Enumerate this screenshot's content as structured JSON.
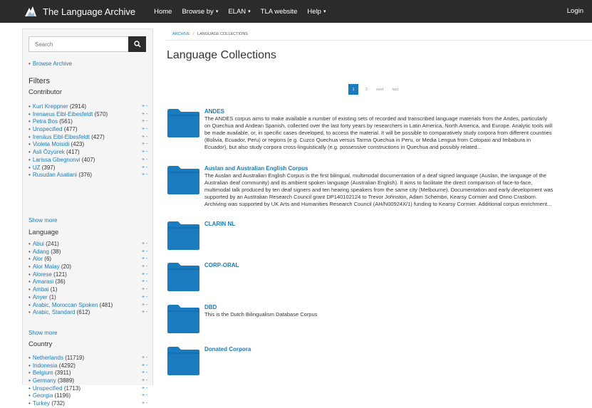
{
  "navbar": {
    "brand": "The Language Archive",
    "items": [
      {
        "label": "Home",
        "dropdown": false
      },
      {
        "label": "Browse by",
        "dropdown": true
      },
      {
        "label": "ELAN",
        "dropdown": true
      },
      {
        "label": "TLA website",
        "dropdown": false
      },
      {
        "label": "Help",
        "dropdown": true
      }
    ],
    "login": "Login",
    "bg_color": "#2b2b2b"
  },
  "sidebar": {
    "search_placeholder": "Search",
    "browse_link": "Browse Archive",
    "filters_heading": "Filters",
    "plus_minus": "+ -",
    "show_more": "Show more",
    "sections": [
      {
        "heading": "Contributor",
        "items": [
          {
            "name": "Kurt Kreppner",
            "count": "(2914)"
          },
          {
            "name": "Irenaeus Eibl-Eibesfeldt",
            "count": "(570)"
          },
          {
            "name": "Petra Bos",
            "count": "(561)"
          },
          {
            "name": "Unspecified",
            "count": "(477)"
          },
          {
            "name": "Irenäus Eibl-Eibesfeldt",
            "count": "(427)"
          },
          {
            "name": "Violeta Moisidi",
            "count": "(423)"
          },
          {
            "name": "Asli Özyürek",
            "count": "(417)"
          },
          {
            "name": "Larissa Gbegnonvi",
            "count": "(407)"
          },
          {
            "name": "UZ",
            "count": "(397)"
          },
          {
            "name": "Rusudan Asatiani",
            "count": "(376)"
          }
        ]
      },
      {
        "heading": "Language",
        "items": [
          {
            "name": "Abui",
            "count": "(241)"
          },
          {
            "name": "Adang",
            "count": "(38)"
          },
          {
            "name": "Alor",
            "count": "(6)"
          },
          {
            "name": "Alor Malay",
            "count": "(20)"
          },
          {
            "name": "Alorese",
            "count": "(121)"
          },
          {
            "name": "Amarasi",
            "count": "(36)"
          },
          {
            "name": "Ambai",
            "count": "(1)"
          },
          {
            "name": "Anyer",
            "count": "(1)"
          },
          {
            "name": "Arabic, Moroccan Spoken",
            "count": "(481)"
          },
          {
            "name": "Arabic, Standard",
            "count": "(612)"
          }
        ]
      },
      {
        "heading": "Country",
        "items": [
          {
            "name": "Netherlands",
            "count": "(11719)"
          },
          {
            "name": "Indonesia",
            "count": "(4292)"
          },
          {
            "name": "Belgium",
            "count": "(3911)"
          },
          {
            "name": "Germany",
            "count": "(3889)"
          },
          {
            "name": "Unspecified",
            "count": "(1713)"
          },
          {
            "name": "Georgia",
            "count": "(1196)"
          },
          {
            "name": "Turkey",
            "count": "(732)"
          }
        ]
      }
    ]
  },
  "main": {
    "breadcrumb": {
      "root": "ARCHIVE",
      "separator": "/",
      "current": "LANGUAGE COLLECTIONS"
    },
    "title": "Language Collections",
    "pagination": {
      "active": "1",
      "pages": [
        "2"
      ],
      "next": "next",
      "last": "last"
    },
    "collections": [
      {
        "title": "ANDES",
        "description_lines": [
          "The ANDES corpus aims to make available a number of existing sets of recorded and transcribed language materials from the Andes, particularly",
          "on Quechua and Andean Spanish, collected over the last forty years by researchers in Latin America, North America, and Europe. Analytic tools will",
          "be made available, or, in specific cases developed, to access the material. It will be possible to comparatively study corpora from different countries",
          "(Bolivia, Ecuador, Peru) or regions (e.g. Cuzco Quechua versus Tarma Quechua in Peru, or Media Lengua from Cotopaxi and Imbabura in",
          "Ecuador), but also study corpora cross-linguistically (e.g. possessive constructions in Quechua and possibly related..."
        ]
      },
      {
        "title": "Auslan and Australian English Corpus",
        "description_lines": [
          "The Auslan and Australian English Corpus is the first bilingual, multimodal documentation of a deaf signed language (Auslan, the language of the",
          "Australian deaf community) and its ambient spoken language (Australian English). It aims to facilitate the direct comparison of face-to-face,",
          "multimodal talk produced by ten deaf signers and ten hearing speakers from the same city (Melbourne). Documentation and early development was",
          "supported by an Australian Research Council grant DP140102124 to Trevor Johnston, Adam Schembri, Kearsy Cormier and Onno Crasborn.",
          "Archiving was supported by UK Arts and Humanities Research Council (AH/N00924X/1) funding to Kearsy Cormier. Additional corpus enrichment..."
        ]
      },
      {
        "title": "CLARIN NL",
        "description_lines": []
      },
      {
        "title": "CORP-ORAL",
        "description_lines": []
      },
      {
        "title": "DBD",
        "description_lines": [
          "This is the Dutch Bilingualism Database Corpus"
        ]
      },
      {
        "title": "Donated Corpora",
        "description_lines": []
      }
    ]
  },
  "colors": {
    "link": "#1a7bbf",
    "folder": "#1a7bbf",
    "navbar": "#2b2b2b"
  }
}
